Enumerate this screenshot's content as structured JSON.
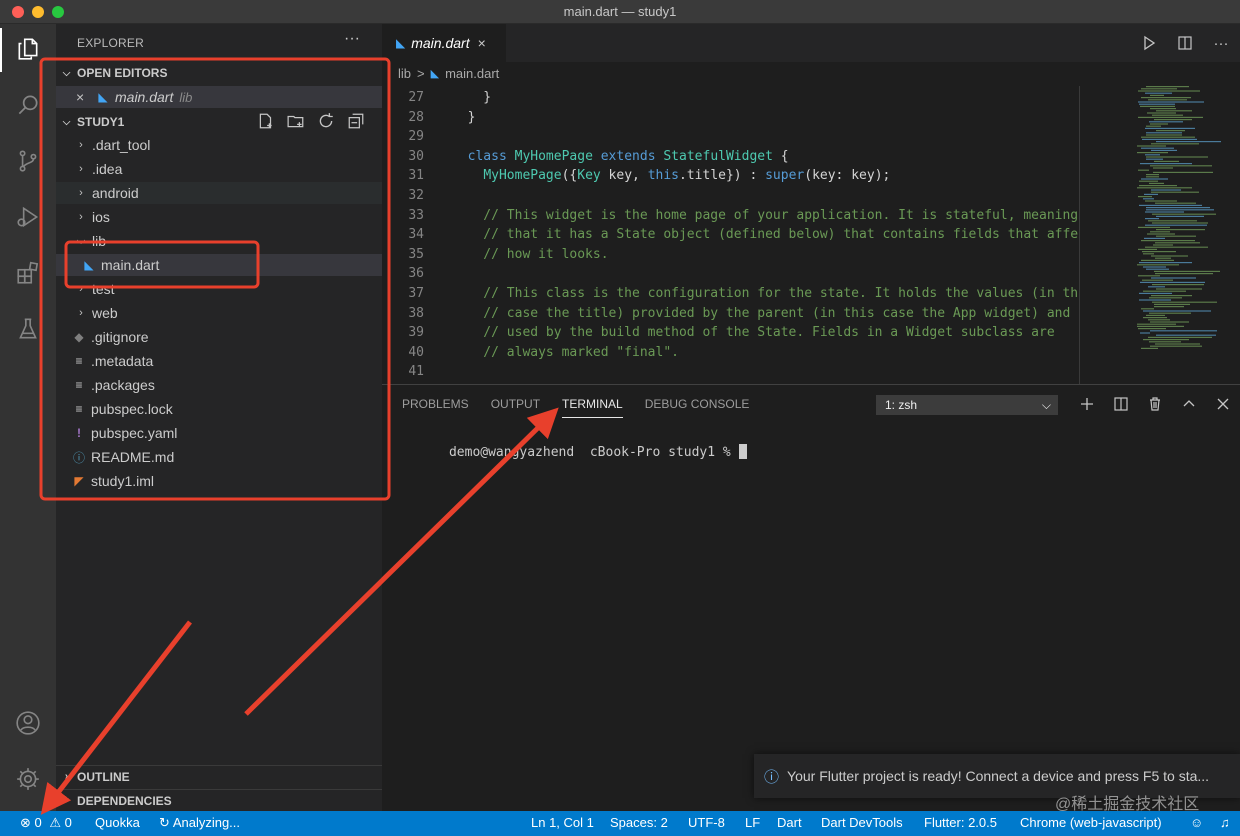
{
  "window": {
    "title": "main.dart — study1"
  },
  "colors": {
    "accent": "#007acc",
    "annotation": "#e8402c"
  },
  "activity_bar": {
    "icons": [
      "explorer-icon",
      "search-icon",
      "source-control-icon",
      "run-debug-icon",
      "extensions-icon",
      "testing-icon",
      "account-icon",
      "settings-gear-icon"
    ]
  },
  "sidebar": {
    "title": "EXPLORER",
    "more": "···",
    "open_editors": {
      "header": "OPEN EDITORS",
      "items": [
        {
          "name": "main.dart",
          "path": "lib"
        }
      ]
    },
    "project": {
      "header": "STUDY1",
      "tree": [
        {
          "name": ".dart_tool"
        },
        {
          "name": ".idea"
        },
        {
          "name": "android"
        },
        {
          "name": "ios"
        },
        {
          "name": "lib"
        },
        {
          "name": "main.dart"
        },
        {
          "name": "test"
        },
        {
          "name": "web"
        },
        {
          "name": ".gitignore"
        },
        {
          "name": ".metadata"
        },
        {
          "name": ".packages"
        },
        {
          "name": "pubspec.lock"
        },
        {
          "name": "pubspec.yaml"
        },
        {
          "name": "README.md"
        },
        {
          "name": "study1.iml"
        }
      ]
    },
    "outline_header": "OUTLINE",
    "dependencies_header": "DEPENDENCIES"
  },
  "editor": {
    "tab": {
      "label": "main.dart",
      "close": "×"
    },
    "breadcrumb": {
      "folder": "lib",
      "separator": ">",
      "file": "main.dart"
    },
    "code": {
      "line_numbers": [
        "27",
        "28",
        "29",
        "30",
        "31",
        "32",
        "33",
        "34",
        "35",
        "36",
        "37",
        "38",
        "39",
        "40",
        "41"
      ],
      "lines": [
        "    }",
        "  }",
        "",
        "  class MyHomePage extends StatefulWidget {",
        "    MyHomePage({Key key, this.title}) : super(key: key);",
        "",
        "    // This widget is the home page of your application. It is stateful, meaning",
        "    // that it has a State object (defined below) that contains fields that affect",
        "    // how it looks.",
        "",
        "    // This class is the configuration for the state. It holds the values (in this",
        "    // case the title) provided by the parent (in this case the App widget) and",
        "    // used by the build method of the State. Fields in a Widget subclass are",
        "    // always marked \"final\".",
        ""
      ]
    }
  },
  "panel": {
    "tabs": [
      "PROBLEMS",
      "OUTPUT",
      "TERMINAL",
      "DEBUG CONSOLE"
    ],
    "active_tab": "TERMINAL",
    "terminal_select": "1: zsh",
    "prompt": "demo@wangyazhend  cBook-Pro study1 % "
  },
  "notification": {
    "text": "Your Flutter project is ready! Connect a device and press F5 to sta..."
  },
  "statusbar": {
    "errors": "0",
    "warnings": "0",
    "quokka": "Quokka",
    "analyzing": "Analyzing...",
    "position": "Ln 1, Col 1",
    "spaces": "Spaces: 2",
    "encoding": "UTF-8",
    "eol": "LF",
    "language": "Dart",
    "devtools": "Dart DevTools",
    "flutter": "Flutter: 2.0.5",
    "device": "Chrome (web-javascript)"
  },
  "watermark": "@稀土掘金技术社区"
}
